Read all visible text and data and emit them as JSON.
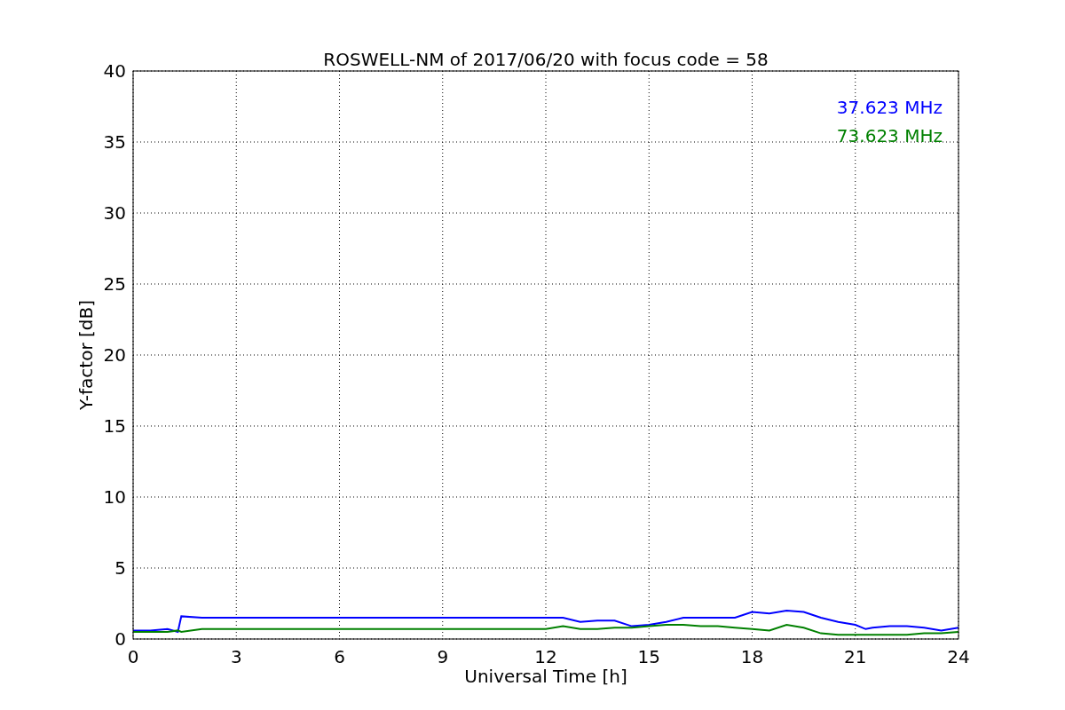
{
  "chart_data": {
    "type": "line",
    "title": "ROSWELL-NM of 2017/06/20 with focus code = 58",
    "xlabel": "Universal Time [h]",
    "ylabel": "Y-factor [dB]",
    "x": [
      0,
      0.5,
      1.0,
      1.3,
      1.4,
      2.0,
      12.0,
      12.5,
      13.0,
      13.5,
      14.0,
      14.5,
      15.0,
      15.5,
      16.0,
      16.5,
      17.0,
      17.5,
      18.0,
      18.5,
      19.0,
      19.5,
      20.0,
      20.5,
      21.0,
      21.3,
      21.5,
      22.0,
      22.5,
      23.0,
      23.5,
      24.0
    ],
    "series": [
      {
        "name": "37.623 MHz",
        "color": "#0000ff",
        "values": [
          0.6,
          0.6,
          0.7,
          0.5,
          1.6,
          1.5,
          1.5,
          1.5,
          1.2,
          1.3,
          1.3,
          0.9,
          1.0,
          1.2,
          1.5,
          1.5,
          1.5,
          1.5,
          1.9,
          1.8,
          2.0,
          1.9,
          1.5,
          1.2,
          1.0,
          0.7,
          0.8,
          0.9,
          0.9,
          0.8,
          0.6,
          0.8
        ]
      },
      {
        "name": "73.623 MHz",
        "color": "#008000",
        "values": [
          0.5,
          0.5,
          0.5,
          0.6,
          0.5,
          0.7,
          0.7,
          0.9,
          0.7,
          0.7,
          0.8,
          0.8,
          0.9,
          1.0,
          1.0,
          0.9,
          0.9,
          0.8,
          0.7,
          0.6,
          1.0,
          0.8,
          0.4,
          0.3,
          0.3,
          0.3,
          0.3,
          0.3,
          0.3,
          0.4,
          0.4,
          0.5
        ]
      }
    ],
    "xlim": [
      0,
      24
    ],
    "ylim": [
      0,
      40
    ],
    "xticks": [
      0,
      3,
      6,
      9,
      12,
      15,
      18,
      21,
      24
    ],
    "yticks": [
      0,
      5,
      10,
      15,
      20,
      25,
      30,
      35,
      40
    ],
    "grid": true
  }
}
